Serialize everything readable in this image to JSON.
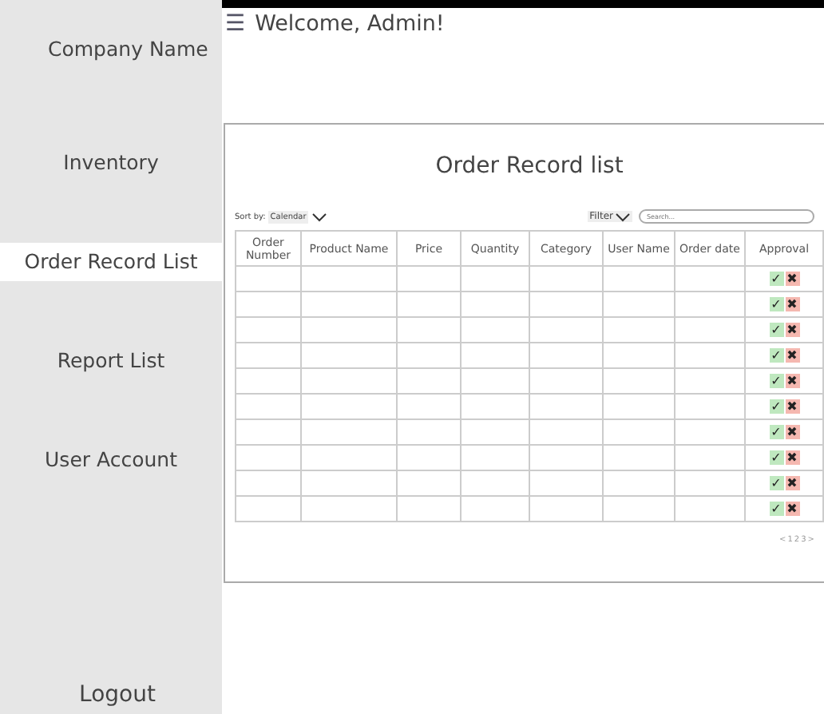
{
  "sidebar": {
    "company": "Company Name",
    "items": [
      {
        "label": "Inventory",
        "selected": false
      },
      {
        "label": "Order Record List",
        "selected": true
      },
      {
        "label": "Report List",
        "selected": false
      },
      {
        "label": "User Account",
        "selected": false
      }
    ],
    "logout": "Logout"
  },
  "header": {
    "menu_icon": "☰",
    "welcome": "Welcome, Admin!"
  },
  "card": {
    "title": "Order Record list",
    "sort_label": "Sort by:",
    "sort_value": "Calendar",
    "filter": "Filter",
    "search_placeholder": "Search...",
    "table": {
      "columns": [
        "Order Number",
        "Product Name",
        "Price",
        "Quantity",
        "Category",
        "User Name",
        "Order date",
        "Approval"
      ],
      "rows": [
        {
          "approve": "✓",
          "reject": "✖"
        },
        {
          "approve": "✓",
          "reject": "✖"
        },
        {
          "approve": "✓",
          "reject": "✖"
        },
        {
          "approve": "✓",
          "reject": "✖"
        },
        {
          "approve": "✓",
          "reject": "✖"
        },
        {
          "approve": "✓",
          "reject": "✖"
        },
        {
          "approve": "✓",
          "reject": "✖"
        },
        {
          "approve": "✓",
          "reject": "✖"
        },
        {
          "approve": "✓",
          "reject": "✖"
        },
        {
          "approve": "✓",
          "reject": "✖"
        }
      ]
    },
    "pagination": [
      "<",
      "1",
      "2",
      "3",
      ">"
    ]
  }
}
